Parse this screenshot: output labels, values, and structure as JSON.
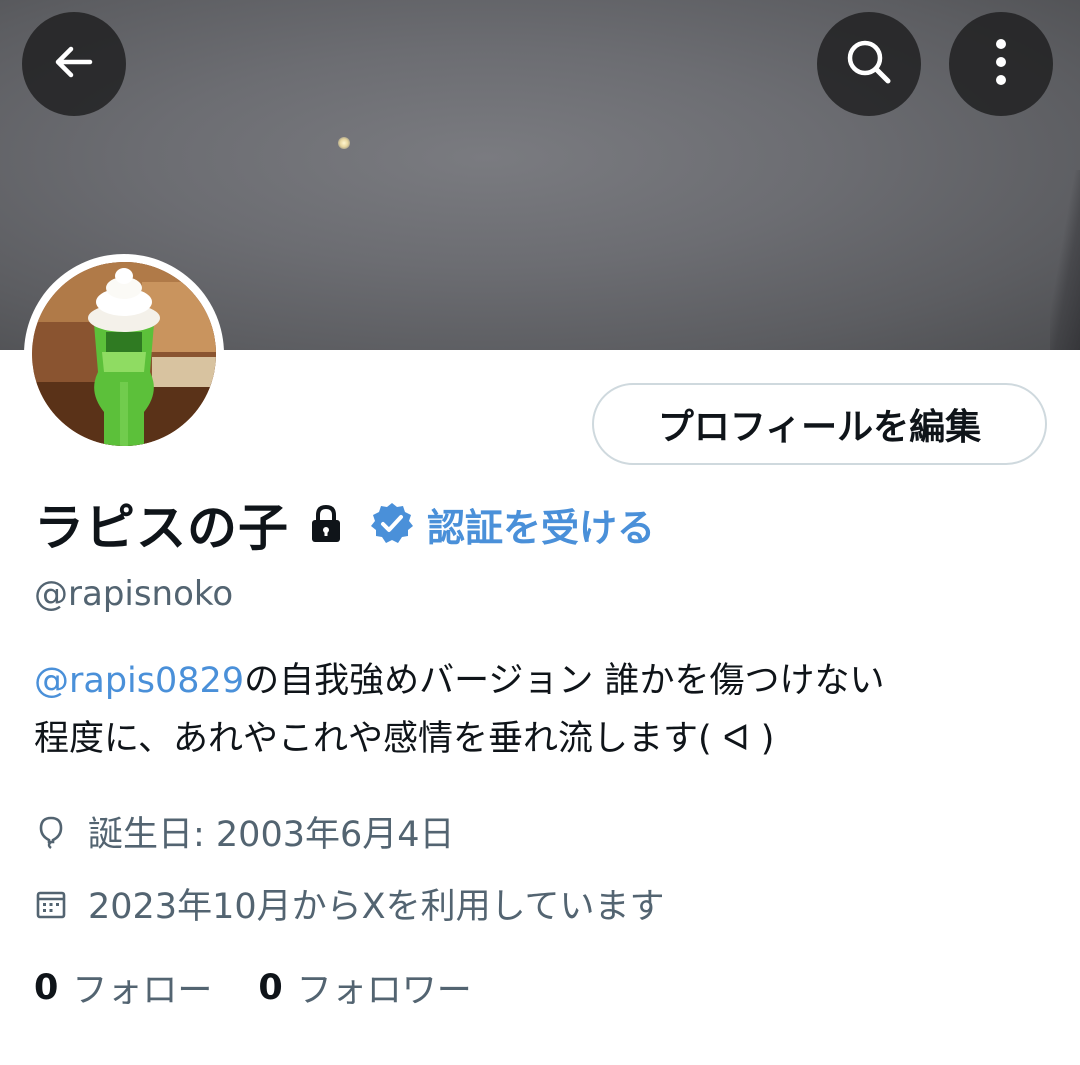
{
  "header": {
    "back_icon": "arrow-left-icon",
    "search_icon": "search-icon",
    "more_icon": "more-vertical-icon"
  },
  "profile": {
    "edit_button_label": "プロフィールを編集",
    "display_name": "ラピスの子",
    "protected_icon": "lock-icon",
    "verified_icon": "verified-badge-icon",
    "get_verified_label": "認証を受ける",
    "handle": "@rapisnoko",
    "bio_mention": "@rapis0829",
    "bio_line1_rest": "の自我強めバージョン 誰かを傷つけない",
    "bio_line2": "程度に、あれやこれや感情を垂れ流します( ᐊ )",
    "birthday": "誕生日: 2003年6月4日",
    "joined": "2023年10月からXを利用しています",
    "following_count": "0",
    "following_label": "フォロー",
    "followers_count": "0",
    "followers_label": "フォロワー"
  },
  "colors": {
    "link": "#4a90d9",
    "text": "#0f1419",
    "secondary_text": "#536471",
    "button_border": "#cfd9de",
    "verified_badge": "#4a90d9"
  }
}
